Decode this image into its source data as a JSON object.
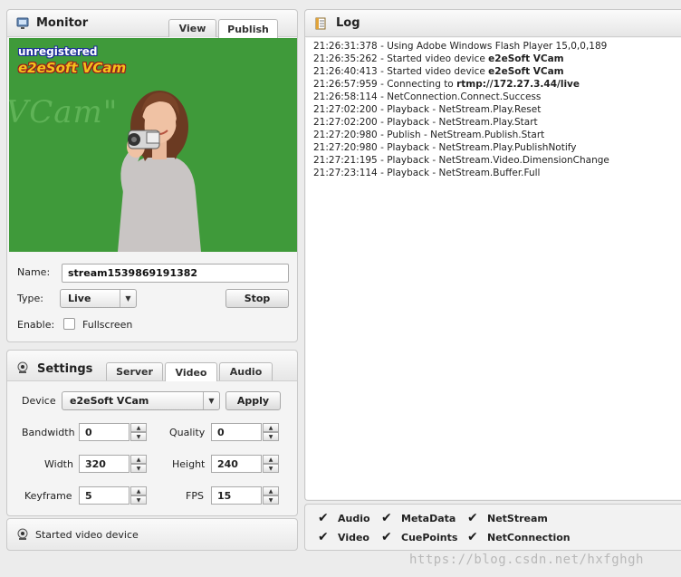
{
  "monitor": {
    "title": "Monitor",
    "tabs": [
      {
        "label": "View"
      },
      {
        "label": "Publish"
      }
    ],
    "overlay_line1": "unregistered",
    "overlay_line2": "e2eSoft VCam",
    "watermark": "\"VCam\"",
    "name_label": "Name:",
    "name_value": "stream1539869191382",
    "type_label": "Type:",
    "type_value": "Live",
    "stop_label": "Stop",
    "enable_label": "Enable:",
    "fullscreen_label": "Fullscreen"
  },
  "settings": {
    "title": "Settings",
    "tabs": [
      {
        "label": "Server"
      },
      {
        "label": "Video"
      },
      {
        "label": "Audio"
      }
    ],
    "device_label": "Device",
    "device_value": "e2eSoft VCam",
    "apply_label": "Apply",
    "bandwidth_label": "Bandwidth",
    "bandwidth_value": "0",
    "quality_label": "Quality",
    "quality_value": "0",
    "width_label": "Width",
    "width_value": "320",
    "height_label": "Height",
    "height_value": "240",
    "keyframe_label": "Keyframe",
    "keyframe_value": "5",
    "fps_label": "FPS",
    "fps_value": "15"
  },
  "status": {
    "text": "Started video device"
  },
  "log": {
    "title": "Log",
    "lines": [
      {
        "text": "21:26:31:378 - Using Adobe Windows Flash Player 15,0,0,189",
        "bold": ""
      },
      {
        "text": "21:26:35:262 - Started video device ",
        "bold": "e2eSoft VCam"
      },
      {
        "text": "21:26:40:413 - Started video device ",
        "bold": "e2eSoft VCam"
      },
      {
        "text": "21:26:57:959 - Connecting to ",
        "bold": "rtmp://172.27.3.44/live"
      },
      {
        "text": "21:26:58:114 - NetConnection.Connect.Success",
        "bold": ""
      },
      {
        "text": "21:27:02:200 - Playback - NetStream.Play.Reset",
        "bold": ""
      },
      {
        "text": "21:27:02:200 - Playback - NetStream.Play.Start",
        "bold": ""
      },
      {
        "text": "21:27:20:980 - Publish - NetStream.Publish.Start",
        "bold": ""
      },
      {
        "text": "21:27:20:980 - Playback - NetStream.Play.PublishNotify",
        "bold": ""
      },
      {
        "text": "21:27:21:195 - Playback - NetStream.Video.DimensionChange",
        "bold": ""
      },
      {
        "text": "21:27:23:114 - Playback - NetStream.Buffer.Full",
        "bold": ""
      }
    ]
  },
  "filters": {
    "items": [
      {
        "label": "Audio"
      },
      {
        "label": "MetaData"
      },
      {
        "label": "NetStream"
      },
      {
        "label": "Video"
      },
      {
        "label": "CuePoints"
      },
      {
        "label": "NetConnection"
      }
    ]
  },
  "footer": {
    "watermark": "https://blog.csdn.net/hxfghgh"
  },
  "colors": {
    "video_bg": "#3f9a3a",
    "accent": "#2a6bb0"
  }
}
